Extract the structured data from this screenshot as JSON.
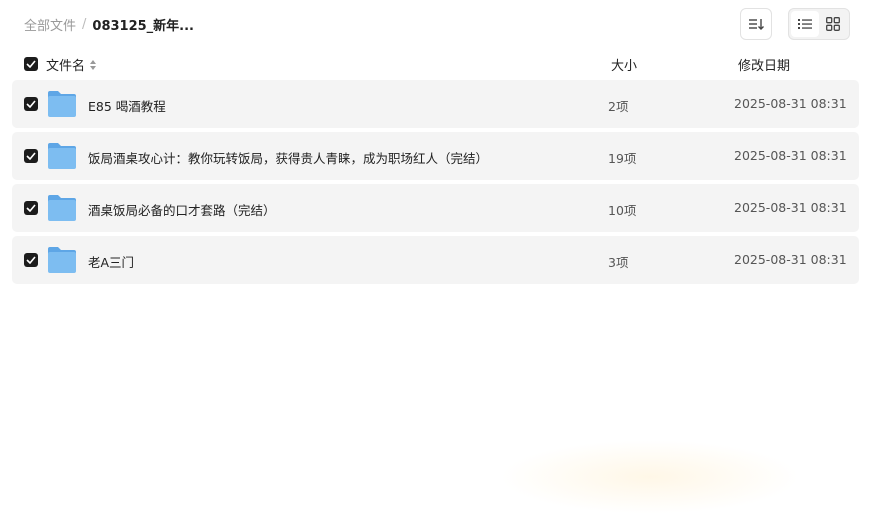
{
  "breadcrumb": {
    "root": "全部文件",
    "separator": "/",
    "current": "083125_新年..."
  },
  "toolbar": {
    "sort_icon": "sort-list-icon",
    "view_list_icon": "list-view-icon",
    "view_grid_icon": "grid-view-icon",
    "active_view": "list"
  },
  "columns": {
    "name": "文件名",
    "size": "大小",
    "date": "修改日期"
  },
  "files": [
    {
      "name": "E85 喝酒教程",
      "size": "2项",
      "date": "2025-08-31 08:31",
      "checked": true
    },
    {
      "name": "饭局酒桌攻心计：教你玩转饭局，获得贵人青睐，成为职场红人（完结）",
      "size": "19项",
      "date": "2025-08-31 08:31",
      "checked": true
    },
    {
      "name": "酒桌饭局必备的口才套路（完结）",
      "size": "10项",
      "date": "2025-08-31 08:31",
      "checked": true
    },
    {
      "name": "老A三门",
      "size": "3项",
      "date": "2025-08-31 08:31",
      "checked": true
    }
  ],
  "colors": {
    "checkbox": "#1c1c1c",
    "row_bg": "#f4f4f4",
    "folder_blue": "#6fb4ec"
  }
}
